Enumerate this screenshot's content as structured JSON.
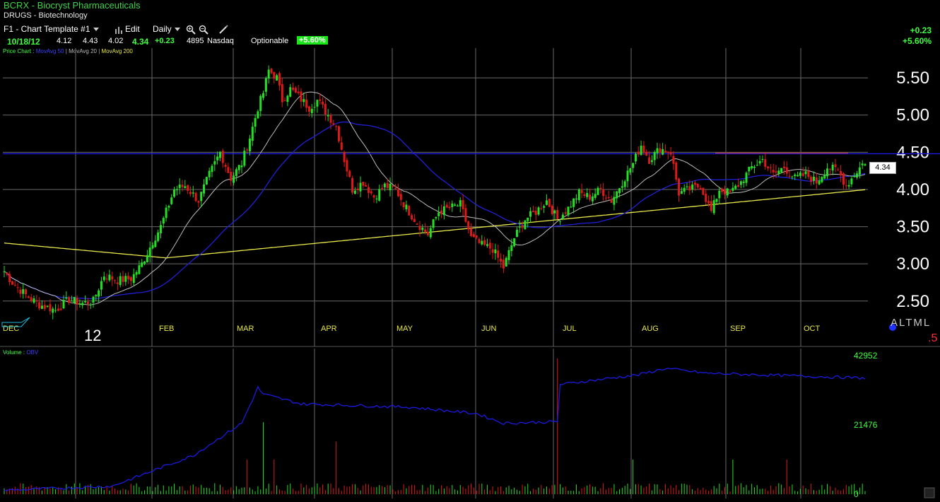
{
  "header": {
    "title": "BCRX - Biocryst Pharmaceuticals",
    "group": "DRUGS - Biotechnology"
  },
  "toolbar": {
    "template_label": "F1 - Chart Template #1",
    "edit_label": "Edit",
    "period_label": "Daily",
    "zoom_in_icon": "zoom-in-icon",
    "zoom_out_icon": "zoom-out-icon",
    "draw_icon": "pencil-icon",
    "bars_icon": "bar-chart-icon"
  },
  "quote": {
    "date": "10/18/12",
    "open": "4.12",
    "high": "4.43",
    "low": "4.02",
    "close": "4.34",
    "change": "+0.23",
    "volume": "4895",
    "exchange": "Nasdaq",
    "optionable": "Optionable",
    "pct_change": "+5.60%"
  },
  "top_right": {
    "change": "+0.23",
    "pct": "+5.60%"
  },
  "legend": {
    "price_chart": "Price Chart :",
    "ma50": "MovAvg 50",
    "ma20": "MovAvg 20",
    "ma200": "MovAvg 200",
    "volume": "Volume :",
    "obv": "OBV"
  },
  "price_tag": "4.34",
  "year_label": "12",
  "side_labels": {
    "altml": "ALTML",
    "five": ".5"
  },
  "colors": {
    "background": "#000000",
    "grid": "#6a6a6a",
    "up_candle": "#22e022",
    "down_candle": "#e01818",
    "ma20": "#bdbdbd",
    "ma50": "#2020d8",
    "ma200": "#e8e84a",
    "resistance_line": "#1a1ae0",
    "obv_line": "#1a1ae0",
    "volume_up": "#22e022",
    "volume_down": "#e01818"
  },
  "chart_data": [
    {
      "type": "candlestick",
      "title": "BCRX - Biocryst Pharmaceuticals",
      "x_labels": [
        "DEC",
        "12",
        "FEB",
        "MAR",
        "APR",
        "MAY",
        "JUN",
        "JUL",
        "AUG",
        "SEP",
        "OCT"
      ],
      "y_ticks": [
        "2.50",
        "3.00",
        "3.50",
        "4.00",
        "4.50",
        "5.00",
        "5.50"
      ],
      "ylim": [
        2.08,
        5.9
      ],
      "grid": true,
      "horizontal_line": 4.48,
      "short_resistance": {
        "value": 4.48,
        "from": "SEP",
        "to": "OCT"
      },
      "series_keyframes": {
        "close": [
          [
            0,
            2.9
          ],
          [
            3,
            2.75
          ],
          [
            8,
            2.58
          ],
          [
            13,
            2.45
          ],
          [
            19,
            2.38
          ],
          [
            24,
            2.52
          ],
          [
            29,
            2.47
          ],
          [
            33,
            2.5
          ],
          [
            37,
            2.85
          ],
          [
            42,
            2.78
          ],
          [
            47,
            2.8
          ],
          [
            51,
            3.0
          ],
          [
            55,
            3.3
          ],
          [
            58,
            3.5
          ],
          [
            63,
            4.0
          ],
          [
            67,
            4.05
          ],
          [
            72,
            3.85
          ],
          [
            76,
            4.2
          ],
          [
            80,
            4.5
          ],
          [
            84,
            4.15
          ],
          [
            88,
            4.35
          ],
          [
            91,
            4.7
          ],
          [
            94,
            5.1
          ],
          [
            96,
            5.3
          ],
          [
            98,
            5.6
          ],
          [
            101,
            5.5
          ],
          [
            103,
            5.2
          ],
          [
            106,
            5.35
          ],
          [
            109,
            5.25
          ],
          [
            113,
            5.1
          ],
          [
            116,
            5.2
          ],
          [
            120,
            5.0
          ],
          [
            123,
            4.85
          ],
          [
            126,
            4.4
          ],
          [
            129,
            4.0
          ],
          [
            133,
            4.1
          ],
          [
            137,
            3.9
          ],
          [
            141,
            4.05
          ],
          [
            145,
            4.0
          ],
          [
            149,
            3.75
          ],
          [
            153,
            3.55
          ],
          [
            157,
            3.4
          ],
          [
            161,
            3.7
          ],
          [
            165,
            3.75
          ],
          [
            169,
            3.8
          ],
          [
            173,
            3.35
          ],
          [
            177,
            3.25
          ],
          [
            181,
            3.2
          ],
          [
            185,
            2.95
          ],
          [
            189,
            3.35
          ],
          [
            193,
            3.6
          ],
          [
            197,
            3.7
          ],
          [
            201,
            3.85
          ],
          [
            205,
            3.6
          ],
          [
            209,
            3.75
          ],
          [
            213,
            3.95
          ],
          [
            217,
            3.9
          ],
          [
            221,
            4.0
          ],
          [
            225,
            3.85
          ],
          [
            229,
            4.1
          ],
          [
            233,
            4.35
          ],
          [
            236,
            4.6
          ],
          [
            239,
            4.4
          ],
          [
            243,
            4.55
          ],
          [
            247,
            4.5
          ],
          [
            250,
            3.95
          ],
          [
            254,
            4.0
          ],
          [
            258,
            4.05
          ],
          [
            262,
            3.7
          ],
          [
            265,
            4.0
          ],
          [
            269,
            3.95
          ],
          [
            273,
            4.1
          ],
          [
            277,
            4.3
          ],
          [
            281,
            4.4
          ],
          [
            285,
            4.2
          ],
          [
            289,
            4.3
          ],
          [
            293,
            4.15
          ],
          [
            297,
            4.2
          ],
          [
            301,
            4.1
          ],
          [
            305,
            4.3
          ],
          [
            309,
            4.25
          ],
          [
            312,
            4.05
          ],
          [
            315,
            4.2
          ],
          [
            318,
            4.34
          ]
        ],
        "obv": [
          [
            0,
            1200
          ],
          [
            40,
            2500
          ],
          [
            70,
            12000
          ],
          [
            88,
            22000
          ],
          [
            94,
            33000
          ],
          [
            96,
            31000
          ],
          [
            110,
            28000
          ],
          [
            150,
            27000
          ],
          [
            175,
            25000
          ],
          [
            185,
            22000
          ],
          [
            205,
            22500
          ],
          [
            206,
            34000
          ],
          [
            215,
            35000
          ],
          [
            235,
            37000
          ],
          [
            245,
            39000
          ],
          [
            260,
            37500
          ],
          [
            280,
            37000
          ],
          [
            300,
            36500
          ],
          [
            319,
            36000
          ]
        ]
      }
    },
    {
      "type": "line",
      "title": "Volume / OBV",
      "y_ticks": [
        "0",
        "21476",
        "42952"
      ],
      "ylim": [
        0,
        42952
      ],
      "series": [
        {
          "name": "OBV"
        }
      ]
    }
  ]
}
